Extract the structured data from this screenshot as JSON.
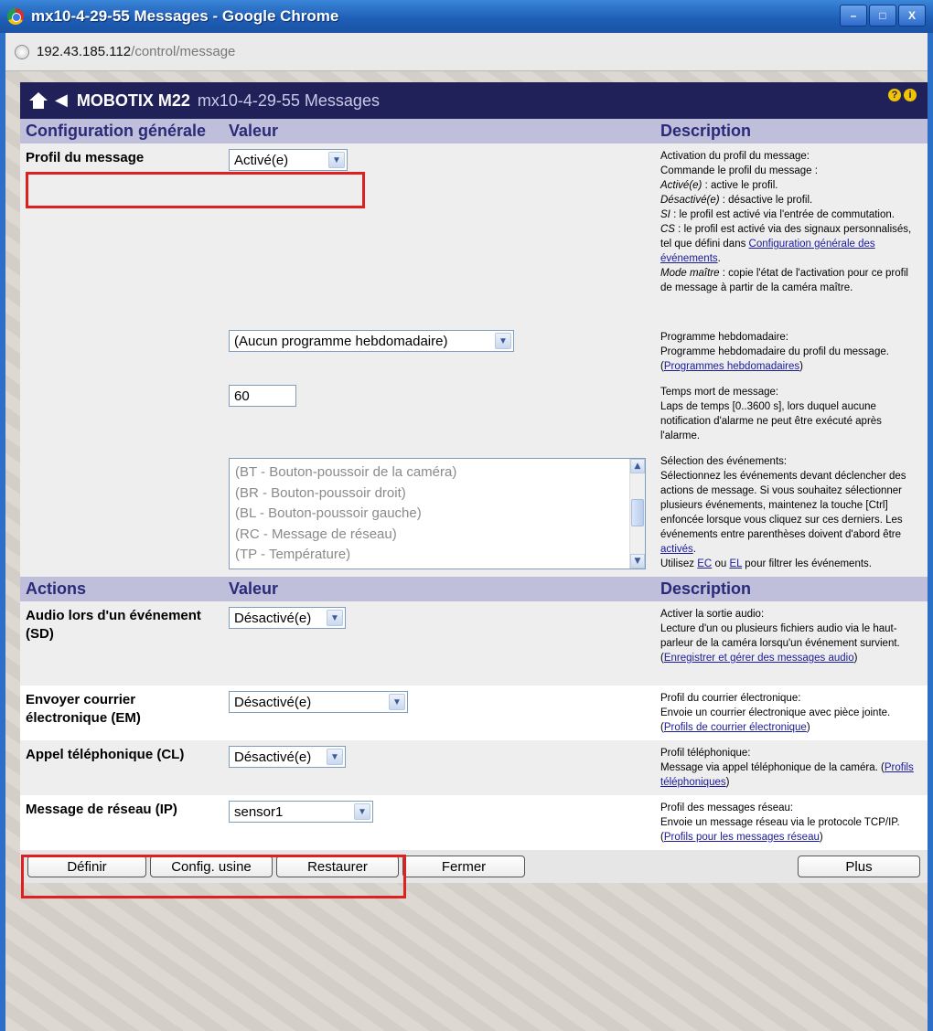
{
  "window": {
    "title": "mx10-4-29-55 Messages - Google Chrome",
    "controls": [
      "–",
      "□",
      "X"
    ]
  },
  "address": {
    "host": "192.43.185.112",
    "path": "/control/message"
  },
  "header": {
    "brand": "MOBOTIX M22",
    "title": "mx10-4-29-55 Messages",
    "help_icons": [
      "?",
      "i"
    ]
  },
  "section1": {
    "col1": "Configuration générale",
    "col2": "Valeur",
    "col3": "Description"
  },
  "profil": {
    "label": "Profil du message",
    "value": "Activé(e)",
    "desc_title": "Activation du profil du message:",
    "desc_l1": "Commande le profil du message :",
    "desc_l2a": "Activé(e)",
    "desc_l2b": " : active le profil.",
    "desc_l3a": "Désactivé(e)",
    "desc_l3b": " : désactive le profil.",
    "desc_l4a": "SI",
    "desc_l4b": " : le profil est activé via l'entrée de commutation.",
    "desc_l5a": "CS",
    "desc_l5b": " : le profil est activé via des signaux personnalisés, tel que défini dans ",
    "desc_link": "Configuration générale des événements",
    "desc_l6a": "Mode maître",
    "desc_l6b": " : copie l'état de l'activation pour ce profil de message à partir de la caméra maître."
  },
  "programme": {
    "value": "(Aucun programme hebdomadaire)",
    "desc_title": "Programme hebdomadaire:",
    "desc_body": "Programme hebdomadaire du profil du message. (",
    "desc_link": "Programmes hebdomadaires",
    "desc_end": ")"
  },
  "temps": {
    "value": "60",
    "desc_title": "Temps mort de message:",
    "desc_body": "Laps de temps [0..3600 s], lors duquel aucune notification d'alarme ne peut être exécuté après l'alarme."
  },
  "events": {
    "options": [
      "(BT - Bouton-poussoir de la caméra)",
      "(BR - Bouton-poussoir droit)",
      "(BL - Bouton-poussoir gauche)",
      "(RC - Message de réseau)",
      "(TP - Température)"
    ],
    "desc_title": "Sélection des événements:",
    "desc_body": "Sélectionnez les événements devant déclencher des actions de message. Si vous souhaitez sélectionner plusieurs événements, maintenez la touche [Ctrl] enfoncée lorsque vous cliquez sur ces derniers. Les événements entre parenthèses doivent d'abord être ",
    "desc_link": "activés",
    "desc_after": ".",
    "desc_filter_a": "Utilisez ",
    "desc_filter_ec": "EC",
    "desc_filter_ou": " ou ",
    "desc_filter_el": "EL",
    "desc_filter_b": " pour filtrer les événements."
  },
  "section2": {
    "col1": "Actions",
    "col2": "Valeur",
    "col3": "Description"
  },
  "audio": {
    "label": "Audio lors d'un événement (SD)",
    "value": "Désactivé(e)",
    "desc_title": "Activer la sortie audio:",
    "desc_body": "Lecture d'un ou plusieurs fichiers audio via le haut-parleur de la caméra lorsqu'un événement survient. (",
    "desc_link": "Enregistrer et gérer des messages audio",
    "desc_end": ")"
  },
  "email": {
    "label": "Envoyer courrier électronique (EM)",
    "value": "Désactivé(e)",
    "desc_title": "Profil du courrier électronique:",
    "desc_body": "Envoie un courrier électronique avec pièce jointe. (",
    "desc_link": "Profils de courrier électronique",
    "desc_end": ")"
  },
  "phone": {
    "label": "Appel téléphonique (CL)",
    "value": "Désactivé(e)",
    "desc_title": "Profil téléphonique:",
    "desc_body": "Message via appel téléphonique de la caméra. (",
    "desc_link": "Profils téléphoniques",
    "desc_end": ")"
  },
  "network": {
    "label": "Message de réseau (IP)",
    "value": "sensor1",
    "desc_title": "Profil des messages réseau:",
    "desc_body": "Envoie un message réseau via le protocole TCP/IP. (",
    "desc_link": "Profils pour les messages réseau",
    "desc_end": ")"
  },
  "buttons": {
    "definir": "Définir",
    "config": "Config. usine",
    "restaurer": "Restaurer",
    "fermer": "Fermer",
    "plus": "Plus"
  },
  "colors": {
    "header_bg": "#21215a",
    "section_bg": "#bfbfdb",
    "highlight": "#e02020"
  }
}
